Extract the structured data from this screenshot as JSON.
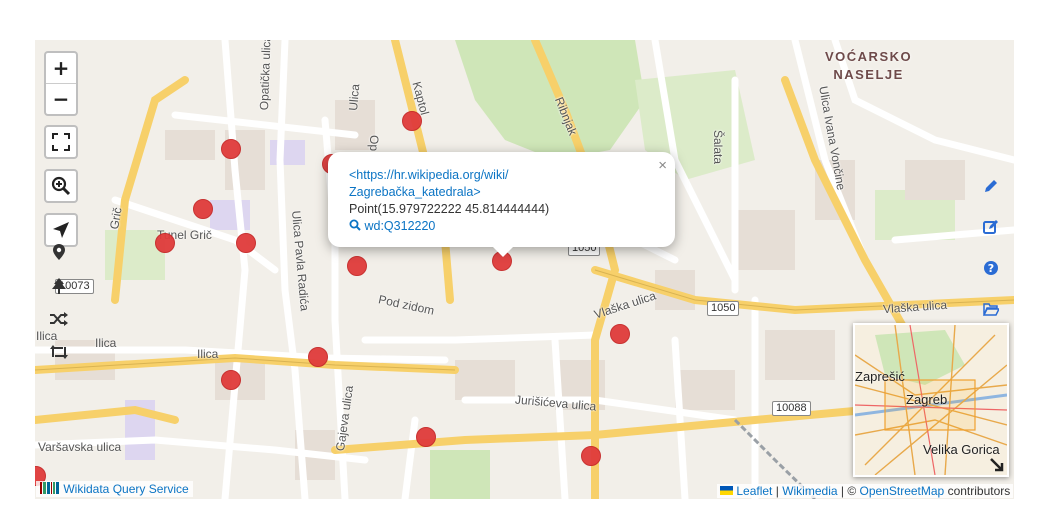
{
  "map": {
    "zoom_in_label": "+",
    "zoom_out_label": "−",
    "district_line1": "VOĆARSKO",
    "district_line2": "NASELJE",
    "streets": [
      "Opatička ulica",
      "Kaptol",
      "Ribnjak",
      "Šalata",
      "Ulica Ivana Vončine",
      "Ulica Pavla Radića",
      "Tunel Grič",
      "Pod zidom",
      "Vlaška ulica",
      "Vlaška ulica",
      "Ilica",
      "Ilica",
      "Ilica",
      "Jurišićeva ulica",
      "Gajeva ulica",
      "Varšavska ulica",
      "Grič",
      "Ulica",
      "Op"
    ],
    "road_numbers": [
      "10073",
      "1050",
      "1050",
      "10088"
    ]
  },
  "popup": {
    "link_line1": "<https://hr.wikipedia.org/wiki/",
    "link_line2": "Zagrebačka_katedrala>",
    "point": "Point(15.979722222 45.814444444)",
    "wd_id": "wd:Q312220",
    "close_symbol": "×"
  },
  "minimap": {
    "labels": [
      "Zaprešić",
      "Zagreb",
      "Velika Gorica"
    ]
  },
  "attribution": {
    "wdqs": "Wikidata Query Service",
    "leaflet": "Leaflet",
    "sep1": "|",
    "wikimedia": "Wikimedia",
    "sep2": "| ©",
    "osm": "OpenStreetMap",
    "contributors": "contributors"
  },
  "colors": {
    "marker": "#e03b3b",
    "link": "#0b74c4",
    "major_road": "#f7d06a",
    "park": "#cfe6b8"
  }
}
